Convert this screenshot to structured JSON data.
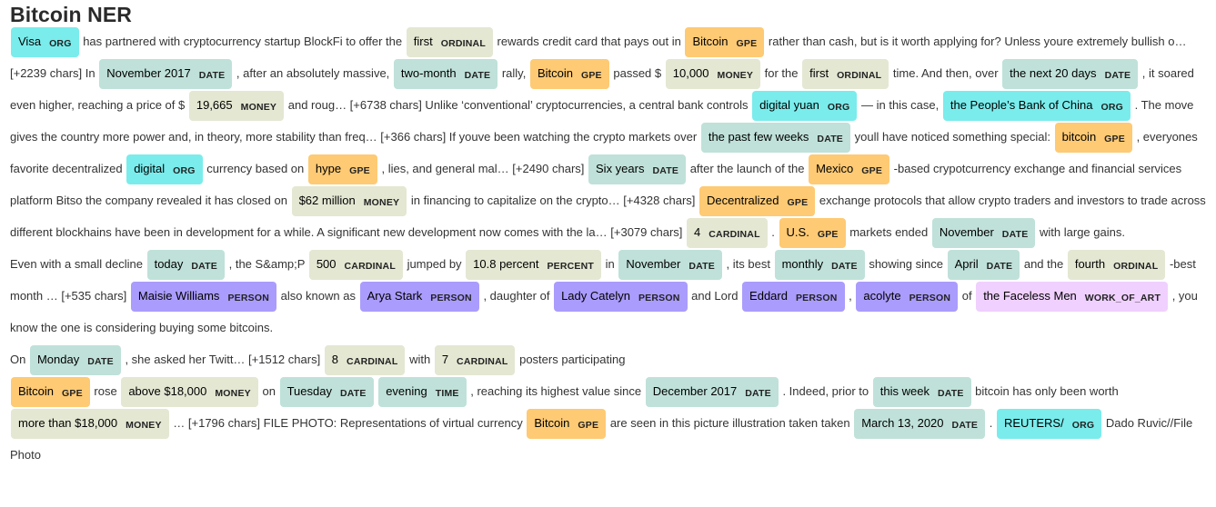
{
  "title": "Bitcoin NER",
  "colors": {
    "ORG": "#7aecec",
    "GPE": "#feca74",
    "DATE": "#bfe1d9",
    "TIME": "#bfe1d9",
    "MONEY": "#e4e7d2",
    "CARDINAL": "#e4e7d2",
    "ORDINAL": "#e4e7d2",
    "PERCENT": "#e4e7d2",
    "PERSON": "#aa9cfc",
    "WORK_OF_ART": "#f0d0ff"
  },
  "segments": [
    {
      "e": "Visa",
      "l": "ORG"
    },
    {
      "t": " has partnered with cryptocurrency startup BlockFi to offer the "
    },
    {
      "e": "first",
      "l": "ORDINAL"
    },
    {
      "t": " rewards credit card that pays out in "
    },
    {
      "e": "Bitcoin",
      "l": "GPE"
    },
    {
      "t": " rather than cash, but is it worth applying for? Unless youre extremely bullish o… [+2239 chars] In "
    },
    {
      "e": "November 2017",
      "l": "DATE"
    },
    {
      "t": " , after an absolutely massive, "
    },
    {
      "e": "two-month",
      "l": "DATE"
    },
    {
      "t": " rally, "
    },
    {
      "e": "Bitcoin",
      "l": "GPE"
    },
    {
      "t": " passed $ "
    },
    {
      "e": "10,000",
      "l": "MONEY"
    },
    {
      "t": " for the "
    },
    {
      "e": "first",
      "l": "ORDINAL"
    },
    {
      "t": " time. And then, over "
    },
    {
      "e": "the next 20 days",
      "l": "DATE"
    },
    {
      "t": " , it soared even higher, reaching a price of $ "
    },
    {
      "e": "19,665",
      "l": "MONEY"
    },
    {
      "t": " and roug… [+6738 chars] Unlike ‘conventional’ cryptocurrencies, a central bank controls "
    },
    {
      "e": "digital yuan",
      "l": "ORG"
    },
    {
      "t": " — in this case, "
    },
    {
      "e": "the People’s Bank of China",
      "l": "ORG"
    },
    {
      "t": " . The move gives the country more power and, in theory, more stability than freq… [+366 chars] If youve been watching the crypto markets over "
    },
    {
      "e": "the past few weeks",
      "l": "DATE"
    },
    {
      "t": " youll have noticed something special: "
    },
    {
      "e": "bitcoin",
      "l": "GPE"
    },
    {
      "t": " , everyones favorite decentralized "
    },
    {
      "e": "digital",
      "l": "ORG"
    },
    {
      "t": " currency based on "
    },
    {
      "e": "hype",
      "l": "GPE"
    },
    {
      "t": " , lies, and general mal… [+2490 chars] "
    },
    {
      "e": "Six years",
      "l": "DATE"
    },
    {
      "t": " after the launch of the "
    },
    {
      "e": "Mexico",
      "l": "GPE"
    },
    {
      "t": " -based crypotcurrency exchange and financial services platform Bitso the company revealed it has closed on "
    },
    {
      "e": "$62 million",
      "l": "MONEY"
    },
    {
      "t": " in financing to capitalize on the crypto… [+4328 chars] "
    },
    {
      "e": "Decentralized",
      "l": "GPE"
    },
    {
      "t": " exchange protocols that allow crypto traders and investors to trade across different blockhains have been in development for a while. A significant new development now comes with the la… [+3079 chars] "
    },
    {
      "e": "4",
      "l": "CARDINAL"
    },
    {
      "t": " . "
    },
    {
      "e": "U.S.",
      "l": "GPE"
    },
    {
      "t": " markets ended "
    },
    {
      "e": "November",
      "l": "DATE"
    },
    {
      "t": " with large gains."
    },
    {
      "br": true
    },
    {
      "t": "Even with a small decline "
    },
    {
      "e": "today",
      "l": "DATE"
    },
    {
      "t": " , the S&amp;P "
    },
    {
      "e": "500",
      "l": "CARDINAL"
    },
    {
      "t": " jumped by "
    },
    {
      "e": "10.8 percent",
      "l": "PERCENT"
    },
    {
      "t": " in "
    },
    {
      "e": "November",
      "l": "DATE"
    },
    {
      "t": " , its best "
    },
    {
      "e": "monthly",
      "l": "DATE"
    },
    {
      "t": " showing since "
    },
    {
      "e": "April",
      "l": "DATE"
    },
    {
      "t": " and the "
    },
    {
      "e": "fourth",
      "l": "ORDINAL"
    },
    {
      "t": " -best month … [+535 chars] "
    },
    {
      "e": "Maisie Williams",
      "l": "PERSON"
    },
    {
      "t": " also known as "
    },
    {
      "e": "Arya Stark",
      "l": "PERSON"
    },
    {
      "t": " , daughter of "
    },
    {
      "e": "Lady Catelyn",
      "l": "PERSON"
    },
    {
      "t": " and Lord "
    },
    {
      "e": "Eddard",
      "l": "PERSON"
    },
    {
      "t": " , "
    },
    {
      "e": "acolyte",
      "l": "PERSON"
    },
    {
      "t": " of "
    },
    {
      "e": "the Faceless Men",
      "l": "WORK_OF_ART"
    },
    {
      "t": " , you know the one is considering buying some bitcoins."
    },
    {
      "br": true
    },
    {
      "t": "On "
    },
    {
      "e": "Monday",
      "l": "DATE"
    },
    {
      "t": " , she asked her Twitt… [+1512 chars] "
    },
    {
      "e": "8",
      "l": "CARDINAL"
    },
    {
      "t": " with "
    },
    {
      "e": "7",
      "l": "CARDINAL"
    },
    {
      "t": " posters participating"
    },
    {
      "br": true
    },
    {
      "e": "Bitcoin",
      "l": "GPE"
    },
    {
      "t": " rose "
    },
    {
      "e": "above $18,000",
      "l": "MONEY"
    },
    {
      "t": " on "
    },
    {
      "e": "Tuesday",
      "l": "DATE"
    },
    {
      "t": " "
    },
    {
      "e": "evening",
      "l": "TIME"
    },
    {
      "t": " , reaching its highest value since "
    },
    {
      "e": "December 2017",
      "l": "DATE"
    },
    {
      "t": " . Indeed, prior to "
    },
    {
      "e": "this week",
      "l": "DATE"
    },
    {
      "t": " bitcoin has only been worth "
    },
    {
      "e": "more than $18,000",
      "l": "MONEY"
    },
    {
      "t": " … [+1796 chars] FILE PHOTO: Representations of virtual currency "
    },
    {
      "e": "Bitcoin",
      "l": "GPE"
    },
    {
      "t": " are seen in this picture illustration taken taken "
    },
    {
      "e": "March 13, 2020",
      "l": "DATE"
    },
    {
      "t": " . "
    },
    {
      "e": "REUTERS/",
      "l": "ORG"
    },
    {
      "t": " Dado Ruvic//File Photo"
    }
  ]
}
